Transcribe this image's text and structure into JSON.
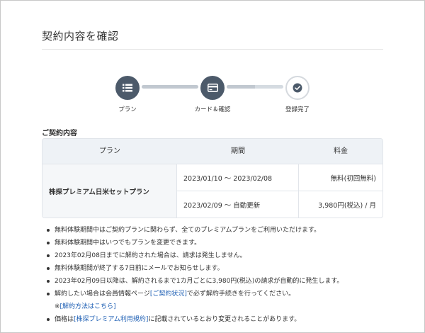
{
  "page": {
    "title": "契約内容を確認"
  },
  "stepper": {
    "steps": [
      {
        "label": "プラン",
        "icon": "list-icon",
        "state": "active"
      },
      {
        "label": "カード＆確認",
        "icon": "credit-card-icon",
        "state": "active"
      },
      {
        "label": "登録完了",
        "icon": "check-icon",
        "state": "pending"
      }
    ],
    "progress": [
      1.0,
      0.5
    ],
    "colors": {
      "active": "#4c5a6a",
      "track": "#d5dbe1",
      "fill": "#c1c8d0"
    }
  },
  "contract": {
    "section_title": "ご契約内容",
    "headers": {
      "plan": "プラン",
      "period": "期間",
      "fee": "料金"
    },
    "plan_name": "株探プレミアム日米セットプラン",
    "rows": [
      {
        "period": "2023/01/10 〜 2023/02/08",
        "fee": "無料(初回無料)"
      },
      {
        "period": "2023/02/09 〜 自動更新",
        "fee": "3,980円(税込) / 月"
      }
    ]
  },
  "notes": {
    "n1": "無料体験期間中はご契約プランに関わらず、全てのプレミアムプランをご利用いただけます。",
    "n2": "無料体験期間中はいつでもプランを変更できます。",
    "n3": "2023年02月08日までに解約された場合は、請求は発生しません。",
    "n4": "無料体験期間が終了する7日前にメールでお知らせします。",
    "n5": "2023年02月09日以降は、解約されるまで1カ月ごとに3,980円(税込)の請求が自動的に発生します。",
    "n6_pre": "解約したい場合は会員情報ページ",
    "n6_link": "[ご契約状況]",
    "n6_post": "で必ず解約手続きを行ってください。",
    "n6_sub_pre": "※",
    "n6_sub_link": "[解約方法はこちら]",
    "n7_pre": "価格は",
    "n7_link": "[株探プレミアム利用規約]",
    "n7_post": "に記載されているとおり変更されることがあります。"
  },
  "colors": {
    "link": "#1e5fb4",
    "header_bg": "#eef2f6"
  }
}
